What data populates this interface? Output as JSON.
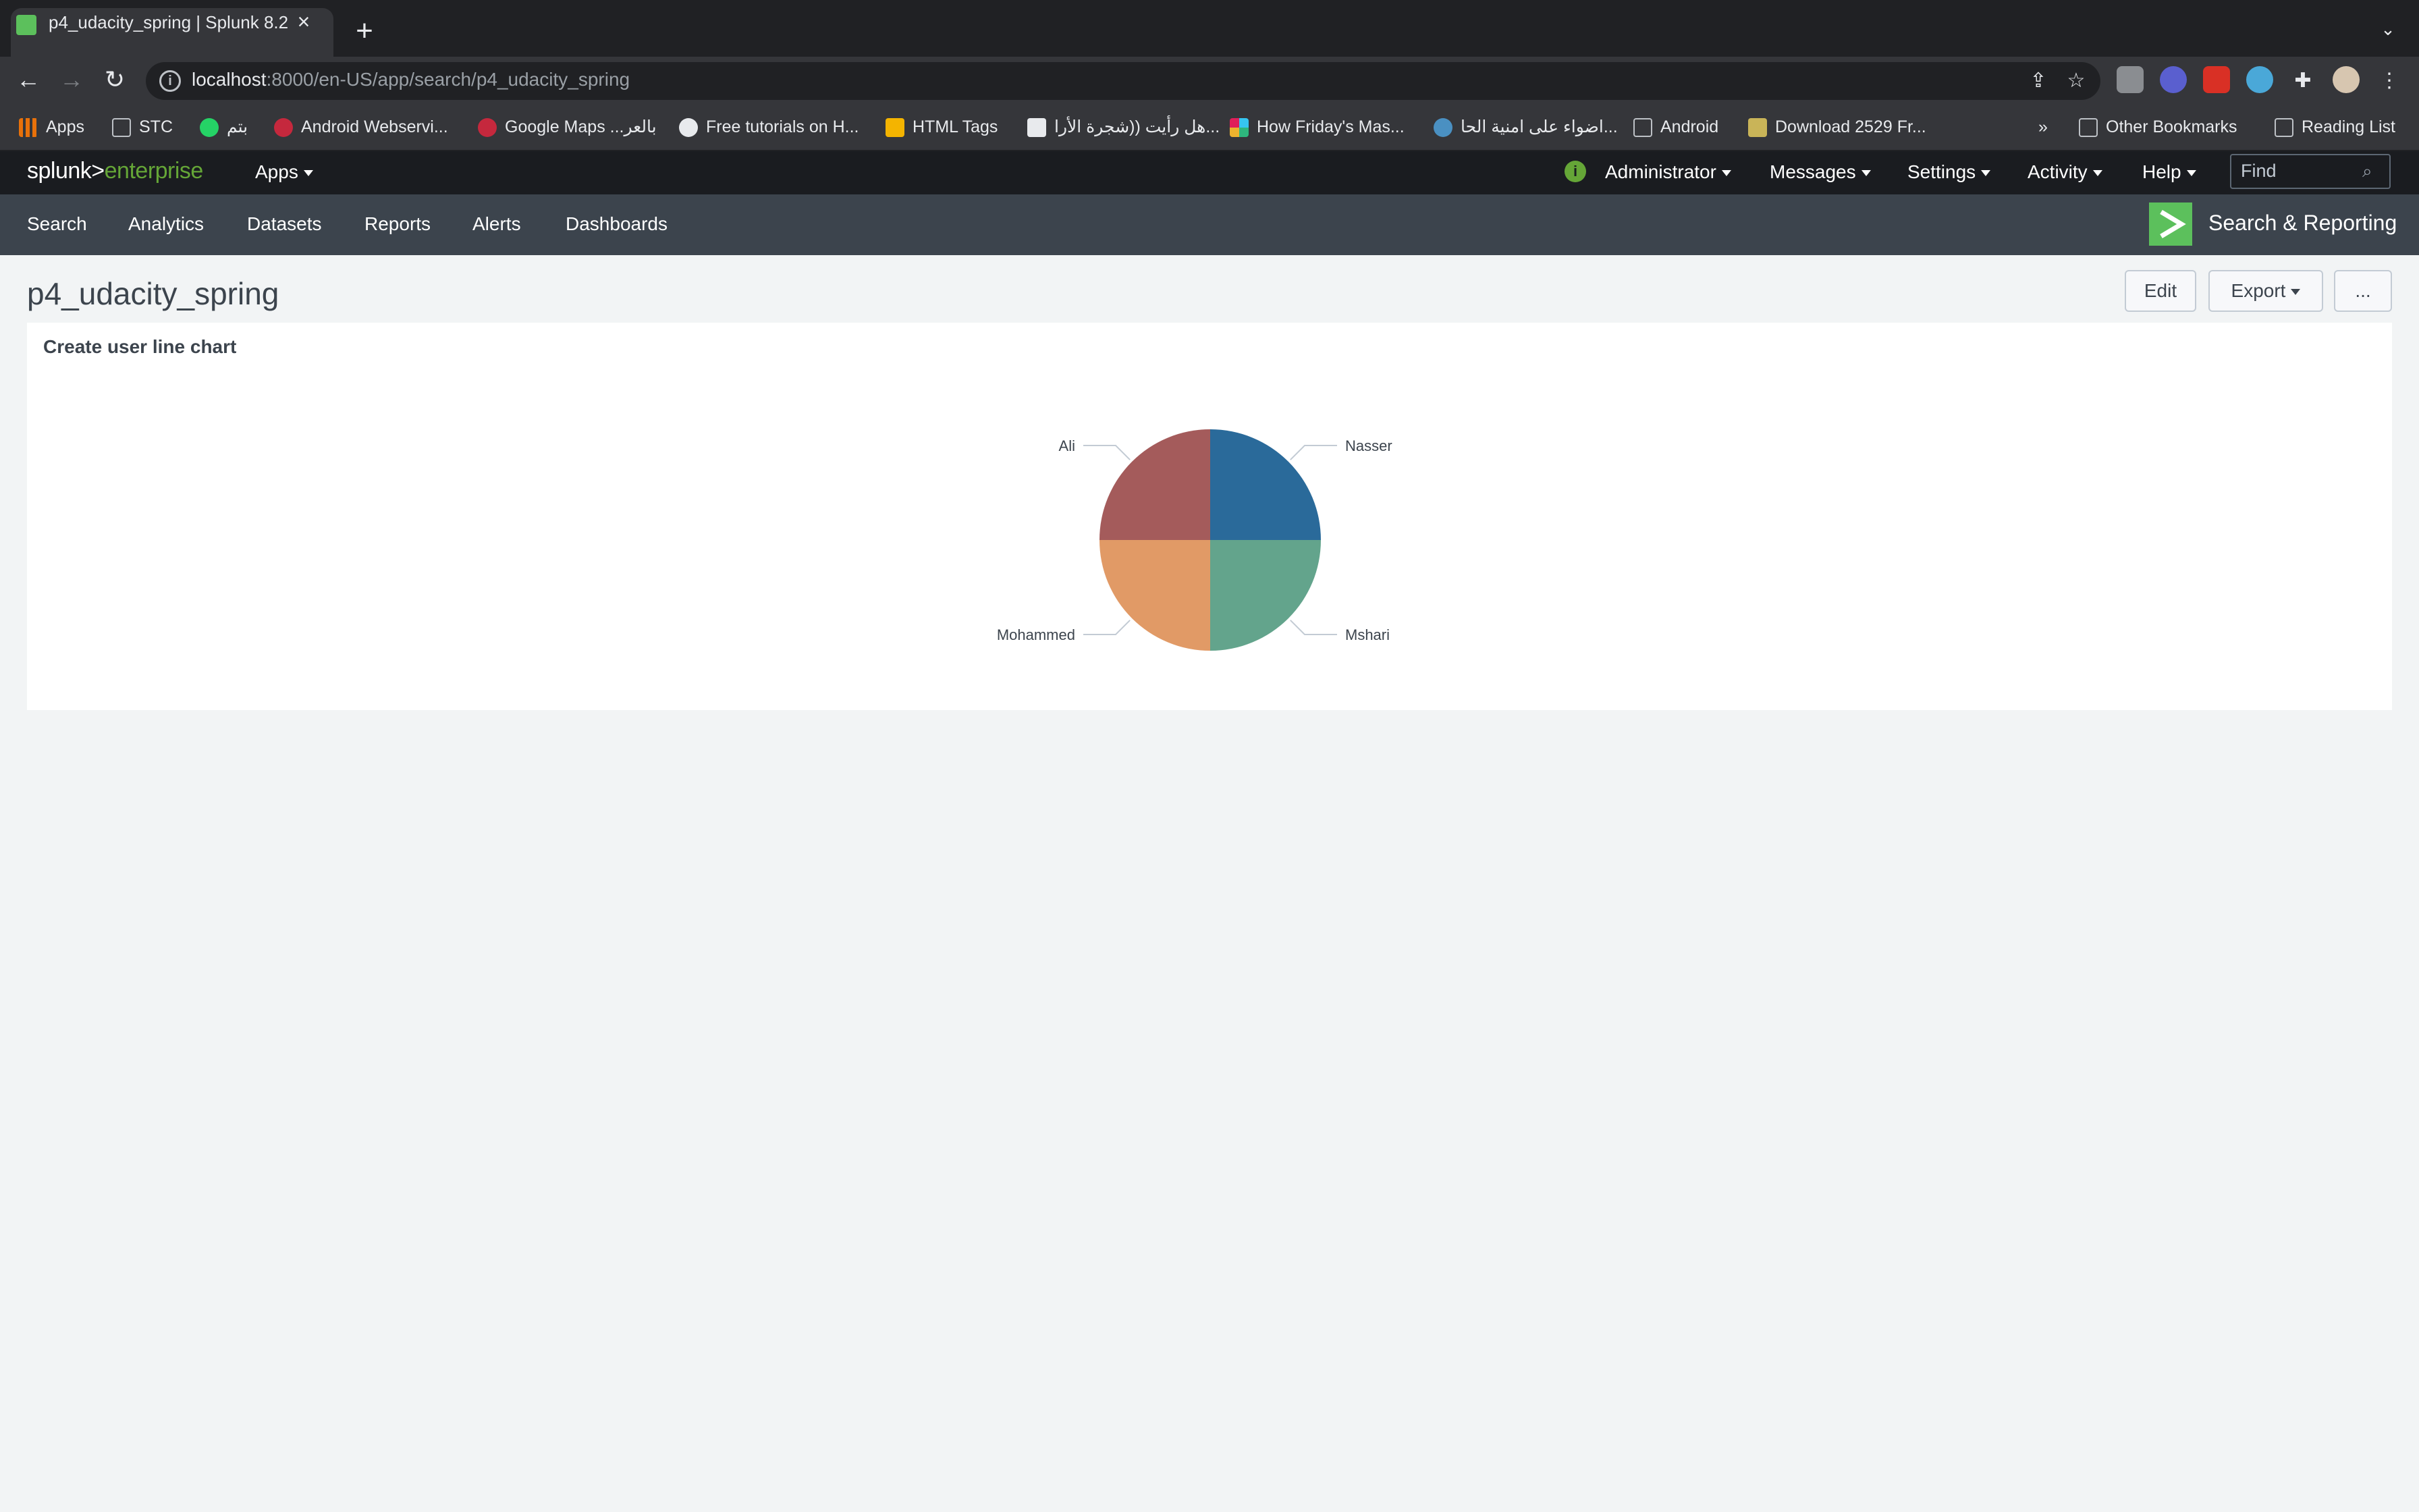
{
  "browser": {
    "tab_title": "p4_udacity_spring | Splunk 8.2",
    "tab_close": "×",
    "new_tab": "+",
    "url_host": "localhost",
    "url_path": ":8000/en-US/app/search/p4_udacity_spring",
    "bookmarks": [
      "Apps",
      "STC",
      "بتم",
      "Android Webservi...",
      "Google Maps ...بالعر",
      "Free tutorials on H...",
      "HTML Tags",
      "هل رأيت ((شجرة الأرا...",
      "How Friday's Mas...",
      "اضواء على امنية الحا...",
      "Android",
      "Download 2529 Fr..."
    ],
    "overflow": "»",
    "other_bookmarks": "Other Bookmarks",
    "reading_list": "Reading List"
  },
  "splunk": {
    "logo_main": "splunk>",
    "logo_sub": "enterprise",
    "apps_menu": "Apps",
    "user_menu": "Administrator",
    "messages_menu": "Messages",
    "settings_menu": "Settings",
    "activity_menu": "Activity",
    "help_menu": "Help",
    "find_placeholder": "Find"
  },
  "app_nav": {
    "items": [
      "Search",
      "Analytics",
      "Datasets",
      "Reports",
      "Alerts",
      "Dashboards"
    ],
    "app_name": "Search & Reporting"
  },
  "dashboard": {
    "title": "p4_udacity_spring",
    "edit_label": "Edit",
    "export_label": "Export",
    "more_label": "...",
    "panel_title": "Create user line chart"
  },
  "colors": {
    "accent": "#5cc05c",
    "nasser": "#2a6a9a",
    "mshari": "#63a48c",
    "mohammed": "#e19a66",
    "ali": "#a45b5b"
  },
  "chart_data": {
    "type": "pie",
    "title": "",
    "slices": [
      {
        "label": "Nasser",
        "value": 1,
        "color": "#2a6a9a"
      },
      {
        "label": "Mshari",
        "value": 1,
        "color": "#63a48c"
      },
      {
        "label": "Mohammed",
        "value": 1,
        "color": "#e19a66"
      },
      {
        "label": "Ali",
        "value": 1,
        "color": "#a45b5b"
      }
    ]
  }
}
